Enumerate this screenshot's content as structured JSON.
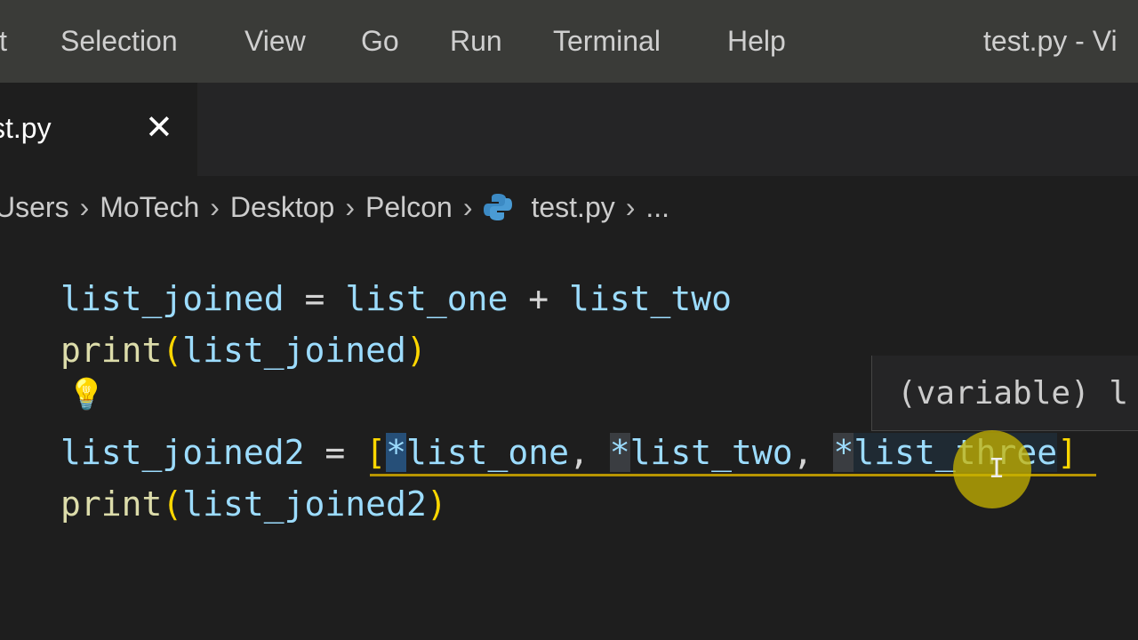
{
  "menubar": {
    "items": [
      "it",
      "Selection",
      "View",
      "Go",
      "Run",
      "Terminal",
      "Help"
    ],
    "title": "test.py - Vi"
  },
  "tab": {
    "label": "st.py",
    "close": "✕"
  },
  "breadcrumbs": [
    "Users",
    "MoTech",
    "Desktop",
    "Pelcon",
    "test.py",
    "..."
  ],
  "code": {
    "line1": {
      "var": "list_joined",
      "eq": " = ",
      "a": "list_one",
      "plus": " + ",
      "b": "list_two"
    },
    "line2": {
      "fn": "print",
      "open": "(",
      "arg": "list_joined",
      "close": ")"
    },
    "line4": {
      "var": "list_joined2",
      "eq": " = ",
      "lb": "[",
      "s1": "*",
      "a": "list_one",
      "c1": ", ",
      "s2": "*",
      "b": "list_two",
      "c2": ", ",
      "s3": "*",
      "c": "list_three",
      "rb": "]"
    },
    "line5": {
      "fn": "print",
      "open": "(",
      "arg": "list_joined2",
      "close": ")"
    }
  },
  "hover": {
    "text": "(variable) l"
  },
  "colors": {
    "variable": "#9cdcfe",
    "function": "#dcdcaa",
    "bracket": "#ffd700",
    "menubar": "#3a3b38",
    "editor": "#1e1e1e"
  }
}
